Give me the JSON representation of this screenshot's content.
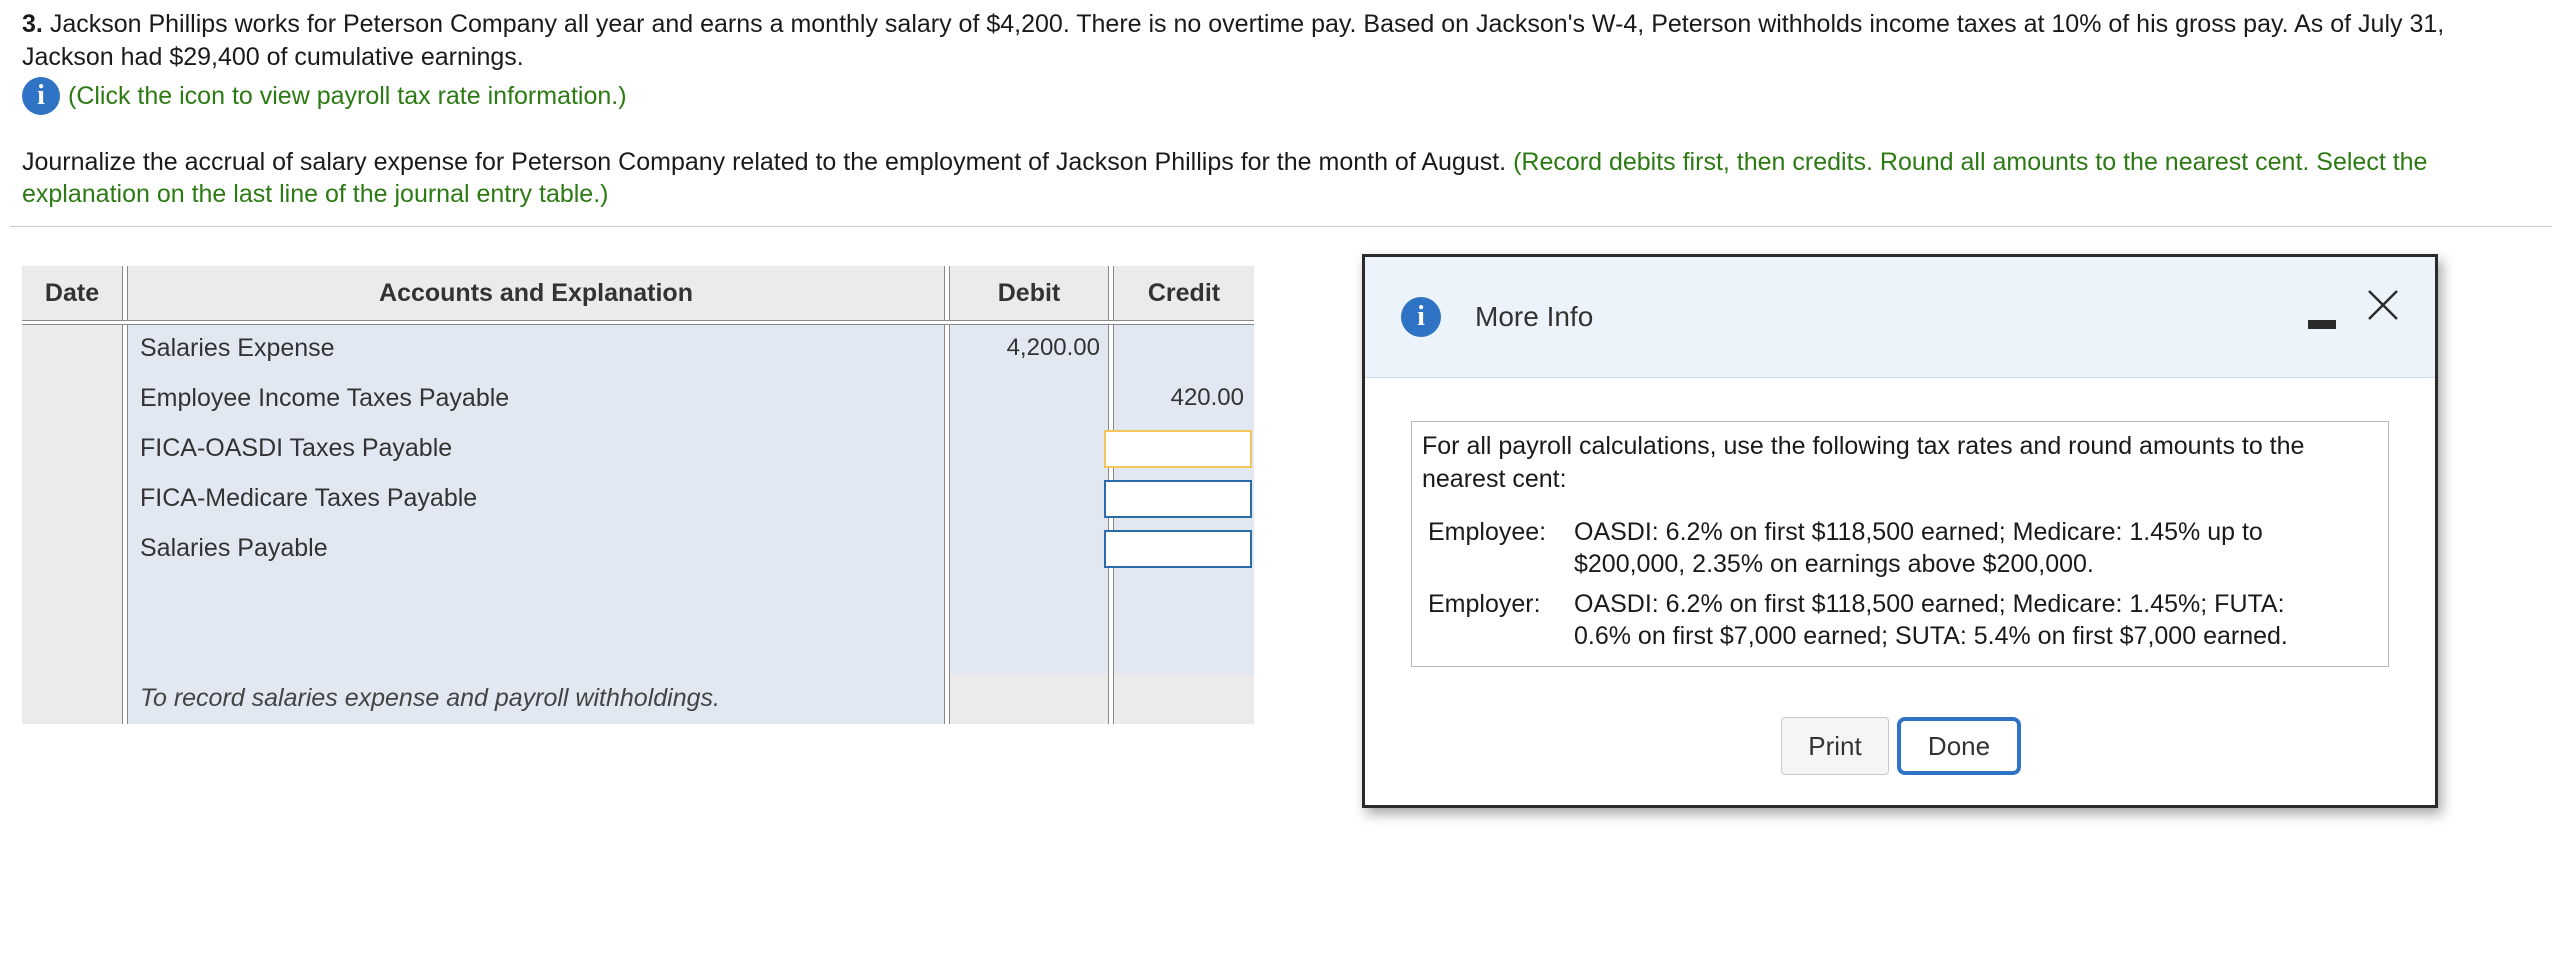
{
  "problem": {
    "number": "3.",
    "text": "Jackson Phillips works for Peterson Company all year and earns a monthly salary of $4,200. There is no overtime pay. Based on Jackson's W-4, Peterson withholds income taxes at 10% of his gross pay. As of July 31, Jackson had $29,400 of cumulative earnings."
  },
  "info_link": {
    "icon": "info-icon",
    "text": "(Click the icon to view payroll tax rate information.)"
  },
  "instructions": {
    "text": "Journalize the accrual of salary expense for Peterson Company related to the employment of Jackson Phillips for the month of August.",
    "hint": "(Record debits first, then credits. Round all amounts to the nearest cent. Select the explanation on the last line of the journal entry table.)"
  },
  "journal": {
    "headers": {
      "date": "Date",
      "accounts": "Accounts and Explanation",
      "debit": "Debit",
      "credit": "Credit"
    },
    "rows": [
      {
        "account": "Salaries Expense",
        "debit": "4,200.00",
        "credit": ""
      },
      {
        "account": "Employee Income Taxes Payable",
        "debit": "",
        "credit": "420.00"
      },
      {
        "account": "FICA-OASDI Taxes Payable",
        "debit": "",
        "credit": ""
      },
      {
        "account": "FICA-Medicare Taxes Payable",
        "debit": "",
        "credit": ""
      },
      {
        "account": "Salaries Payable",
        "debit": "",
        "credit": ""
      }
    ],
    "explanation": "To record salaries expense and payroll withholdings."
  },
  "dialog": {
    "title": "More Info",
    "intro": "For all payroll calculations, use the following tax rates and round amounts to the nearest cent:",
    "employee_label": "Employee:",
    "employee_text": "OASDI: 6.2% on first $118,500 earned; Medicare: 1.45% up to $200,000, 2.35% on earnings above $200,000.",
    "employer_label": "Employer:",
    "employer_text": "OASDI: 6.2% on first $118,500 earned; Medicare: 1.45%; FUTA: 0.6% on first $7,000 earned; SUTA: 5.4% on first $7,000 earned.",
    "print_label": "Print",
    "done_label": "Done"
  },
  "colors": {
    "accent": "#2f74c4",
    "hint_green": "#2c7a13",
    "input_active": "#f3c65a",
    "cell_bg": "#e2e8f2"
  }
}
